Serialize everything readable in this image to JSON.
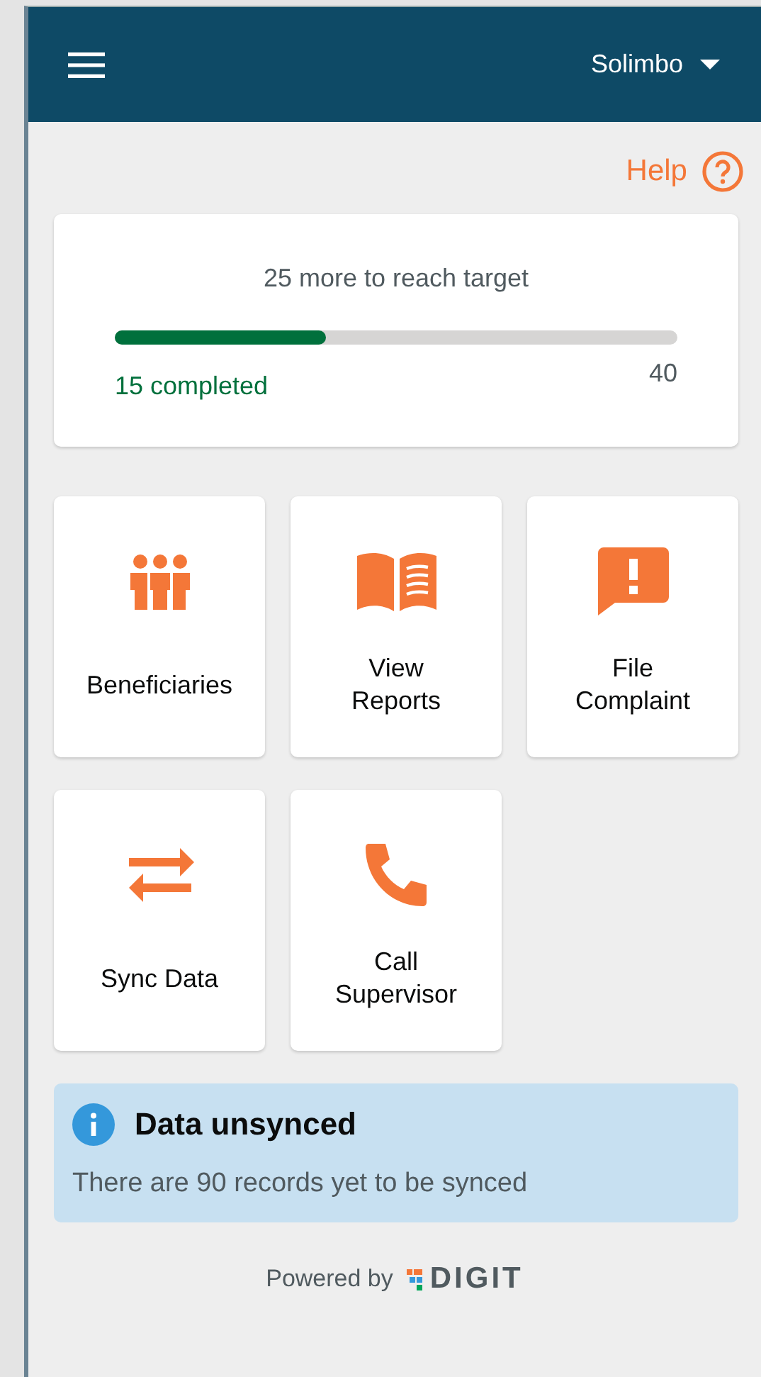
{
  "header": {
    "user": "Solimbo"
  },
  "help": {
    "label": "Help"
  },
  "progress": {
    "title": "25 more to reach target",
    "level": 0.375,
    "completed": "15 completed",
    "target": "40"
  },
  "tiles": [
    {
      "kind": "people",
      "label": "Beneficiaries"
    },
    {
      "kind": "book",
      "label": "View Reports"
    },
    {
      "kind": "complaint",
      "label": "File Complaint"
    },
    {
      "kind": "sync",
      "label": "Sync Data"
    },
    {
      "kind": "phone",
      "label": "Call Supervisor"
    }
  ],
  "banner": {
    "title": "Data unsynced",
    "message": "There are 90 records yet to be synced"
  },
  "footer": {
    "prefix": "Powered by",
    "brand": "DIGIT"
  }
}
